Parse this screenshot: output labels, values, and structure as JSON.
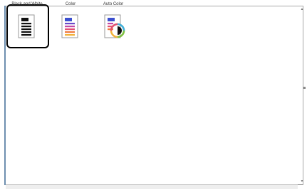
{
  "options": [
    {
      "label": "Black and White",
      "icon": "black-white-document-icon",
      "selected": true
    },
    {
      "label": "Color",
      "icon": "color-document-icon",
      "selected": false
    },
    {
      "label": "Auto Color",
      "icon": "auto-color-document-icon",
      "selected": false
    }
  ],
  "scrollbar": {
    "up": "▲",
    "down": "▼"
  },
  "colors": {
    "selection_ring": "#000000",
    "frame_border": "#a9a9a9",
    "accent": "#6e8fb0"
  }
}
